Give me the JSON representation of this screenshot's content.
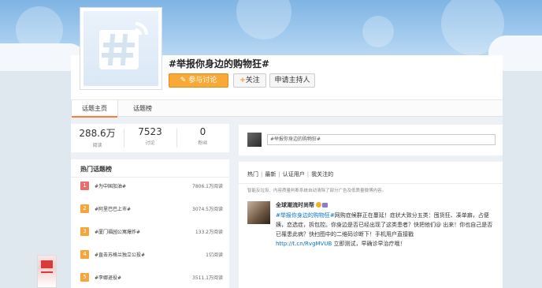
{
  "colors": {
    "banner_top": "#7fb4e4",
    "primary_button": "#f8a937",
    "link": "#0a72c7",
    "tab_active_underline": "#fa7d3c",
    "rank1": "#e86e6e",
    "rank_other": "#f7a43a"
  },
  "icons": {
    "avatar": "hashtag-signal-icon",
    "discuss_button": "edit-icon",
    "follow_button": "plus-icon"
  },
  "header": {
    "title": "#举报你身边的购物狂#",
    "discuss_label": "参与讨论",
    "follow_label": "关注",
    "follow_plus": "+",
    "host_label": "申请主持人"
  },
  "tabs": [
    {
      "label": "话题主页",
      "active": true
    },
    {
      "label": "话题榜",
      "active": false
    }
  ],
  "stats": [
    {
      "value": "288.6万",
      "label": "阅读"
    },
    {
      "value": "7523",
      "label": "讨论"
    },
    {
      "value": "0",
      "label": "粉丝"
    }
  ],
  "hot_topics": {
    "title": "热门话题榜",
    "items": [
      {
        "rank": "1",
        "name": "#为中国加油#",
        "count": "7806.1万阅读"
      },
      {
        "rank": "2",
        "name": "#阿里巴巴上市#",
        "count": "3074.5万阅读"
      },
      {
        "rank": "3",
        "name": "#厦门福园公寓爆炸#",
        "count": "133.2万阅读"
      },
      {
        "rank": "4",
        "name": "#直击苏格兰独立公投#",
        "count": "1亿阅读"
      },
      {
        "rank": "5",
        "name": "#李娜退役#",
        "count": "3511.1万阅读"
      }
    ]
  },
  "post_box": {
    "input_value": "#举报你身边的购物狂#"
  },
  "feed": {
    "tabs": [
      "热门",
      "最新",
      "认证用户",
      "我关注的"
    ],
    "notice": "智能反垃圾、内容质量判断系统自动清除了部分广告及低质量微博内容。",
    "post": {
      "user": "全球潮流时尚帮",
      "topic": "#举报你身边的购物狂#",
      "text_1": "网购症候群正在蔓延！症状大致分五类：囤货狂、凑单癖，占便姨，恋选症，拆包控。你身边是否已经出现了这类患者？快把他们@ 出来！你也自己是否已罹患此病？快扫图中的二维码诊断下！手机用户直接戳",
      "link": "http://t.cn/RvgMVUB",
      "text_2": " 立即测试，早确诊早治疗哦！"
    }
  }
}
